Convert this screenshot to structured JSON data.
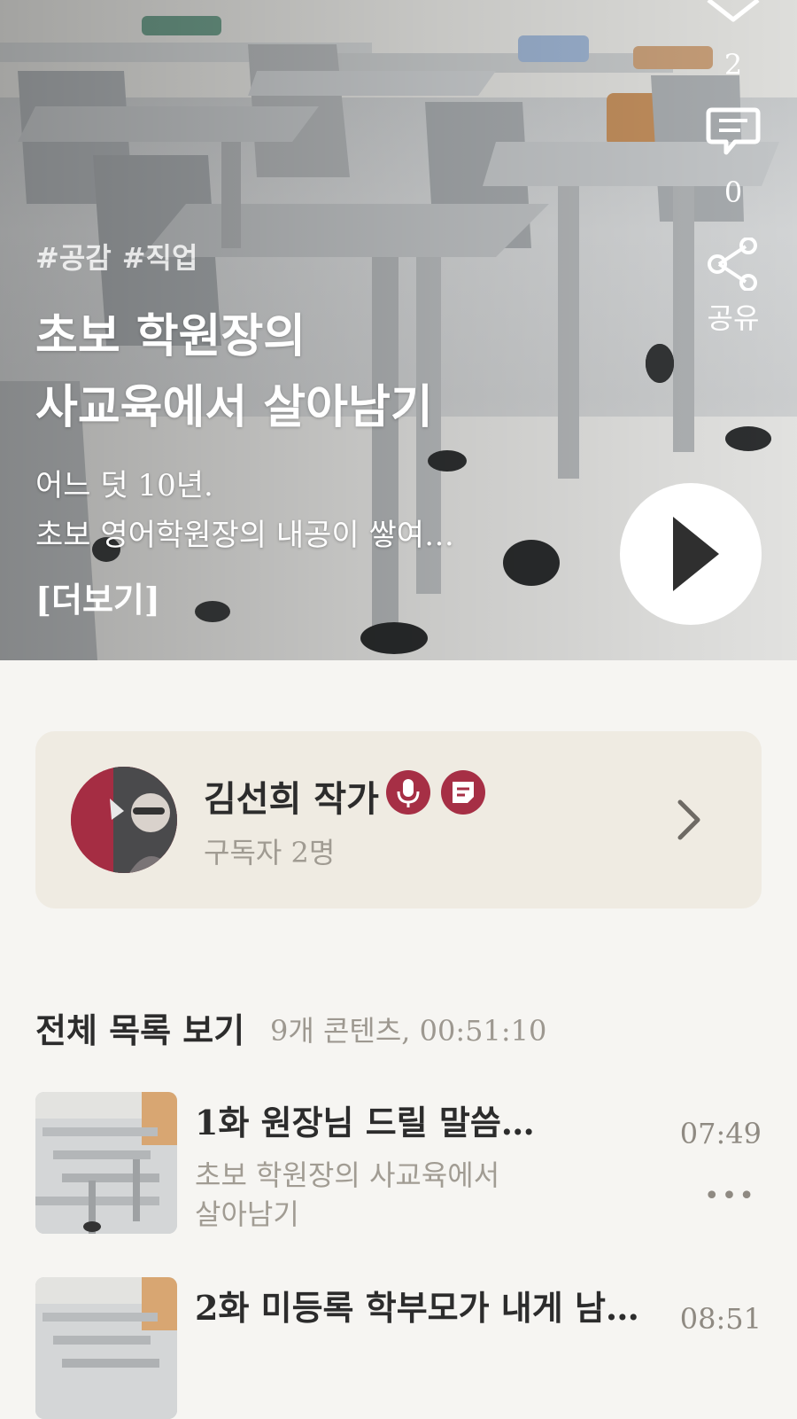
{
  "hero": {
    "tags": [
      "#공감",
      "#직업"
    ],
    "title_lines": [
      "초보 학원장의",
      "사교육에서 살아남기"
    ],
    "description_lines": [
      "어느 덧 10년.",
      "초보 영어학원장의 내공이 쌓여…"
    ],
    "more_label": "[더보기]",
    "like_count": "2",
    "comment_count": "0",
    "share_label": "공유",
    "icons": [
      "heart-icon",
      "comment-icon",
      "share-icon",
      "play-icon"
    ]
  },
  "author": {
    "name": "김선희 작가",
    "subscribers": "구독자 2명",
    "badge_color": "#a62f45",
    "icons": [
      "mic-icon",
      "note-icon",
      "chevron-right-icon"
    ]
  },
  "list": {
    "title": "전체 목록 보기",
    "meta": "9개 콘텐츠, 00:51:10",
    "episodes": [
      {
        "title": "1화 원장님 드릴 말씀…",
        "subtitle": "초보 학원장의 사교육에서 살아남기",
        "duration": "07:49",
        "more": "•••"
      },
      {
        "title": "2화 미등록 학부모가 내게 남…",
        "duration": "08:51"
      }
    ]
  },
  "colors": {
    "background": "#f6f5f2",
    "card": "#efebe2",
    "accent": "#a62f45"
  }
}
